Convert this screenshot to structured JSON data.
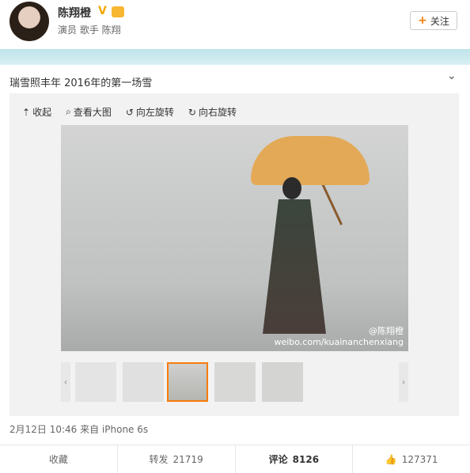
{
  "user": {
    "name": "陈翔橙",
    "desc": "演员 歌手 陈翔",
    "follow_label": "关注",
    "verified_mark": "V"
  },
  "post": {
    "text": "瑞雪照丰年 2016年的第一场雪",
    "meta": "2月12日 10:46 来自 iPhone 6s",
    "watermark_user": "@陈翔橙",
    "watermark_url": "weibo.com/kuainanchenxiang"
  },
  "toolbar": {
    "collapse": "收起",
    "view_large": "查看大图",
    "rotate_left": "向左旋转",
    "rotate_right": "向右旋转"
  },
  "actions": {
    "favorite": "收藏",
    "repost_label": "转发",
    "repost_count": "21719",
    "comment_label": "评论",
    "comment_count": "8126",
    "like_count": "127371"
  },
  "icons": {
    "collapse": "up-arrow-icon",
    "view_large": "magnifier-icon",
    "rotate_left": "rotate-left-icon",
    "rotate_right": "rotate-right-icon",
    "like": "thumbs-up-icon"
  },
  "colors": {
    "accent": "#f77b0a"
  }
}
